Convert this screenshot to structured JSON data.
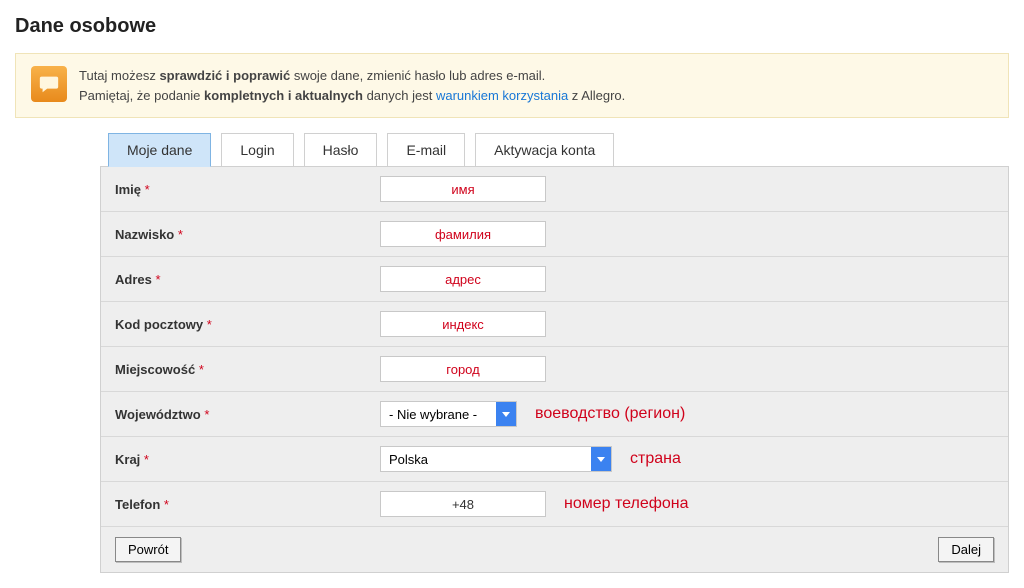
{
  "page_title": "Dane osobowe",
  "notice": {
    "line1_prefix": "Tutaj możesz ",
    "line1_bold": "sprawdzić i poprawić",
    "line1_suffix": " swoje dane, zmienić hasło lub adres e-mail.",
    "line2_prefix": "Pamiętaj, że podanie ",
    "line2_bold": "kompletnych i aktualnych",
    "line2_middle": " danych jest ",
    "line2_link": "warunkiem korzystania",
    "line2_suffix": " z Allegro."
  },
  "tabs": {
    "t0": "Moje dane",
    "t1": "Login",
    "t2": "Hasło",
    "t3": "E-mail",
    "t4": "Aktywacja konta"
  },
  "fields": {
    "imie": {
      "label": "Imię",
      "value": "имя",
      "annot": ""
    },
    "nazwisko": {
      "label": "Nazwisko",
      "value": "фамилия",
      "annot": ""
    },
    "adres": {
      "label": "Adres",
      "value": "адрес",
      "annot": ""
    },
    "kod": {
      "label": "Kod pocztowy",
      "value": "индекс",
      "annot": ""
    },
    "miejscowosc": {
      "label": "Miejscowość",
      "value": "город",
      "annot": ""
    },
    "wojewodztwo": {
      "label": "Województwo",
      "selected": "- Nie wybrane -",
      "annot": "воеводство (регион)"
    },
    "kraj": {
      "label": "Kraj",
      "selected": "Polska",
      "annot": "страна"
    },
    "telefon": {
      "label": "Telefon",
      "value": "+48",
      "annot": "номер телефона"
    }
  },
  "buttons": {
    "back": "Powrót",
    "next": "Dalej"
  },
  "select_widths": {
    "wojewodztwo": "135px",
    "kraj": "230px"
  },
  "required_marker": "*"
}
